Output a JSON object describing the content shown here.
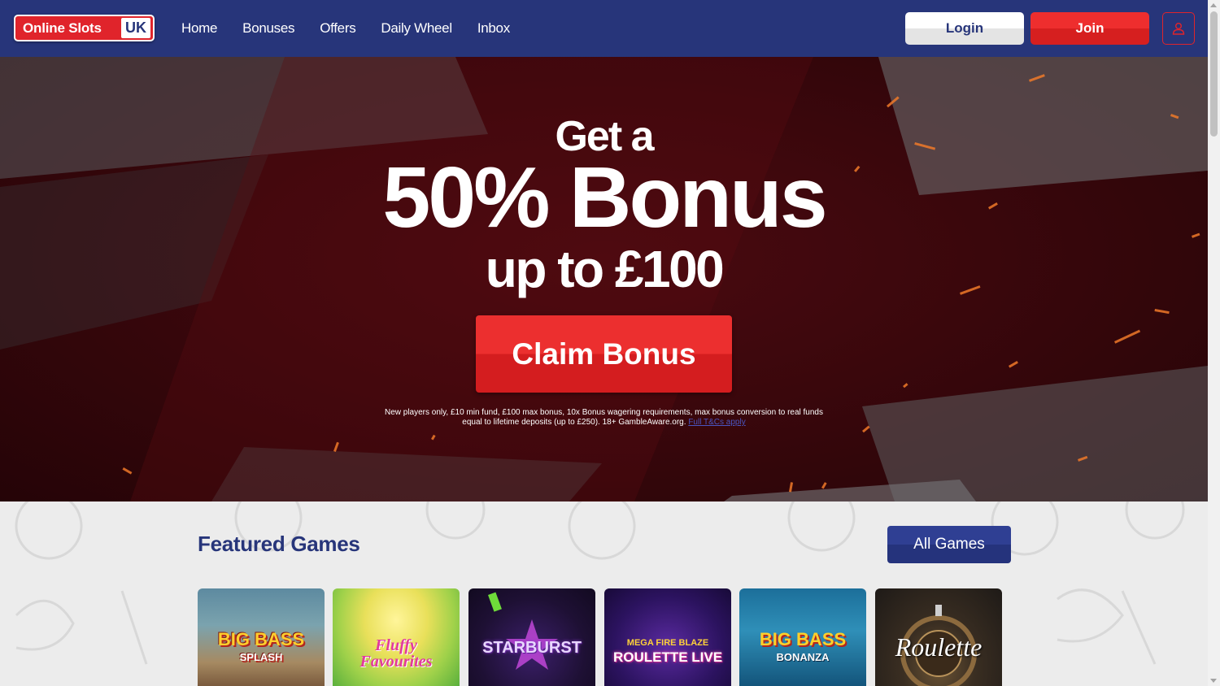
{
  "header": {
    "logo_main": "Online Slots",
    "logo_uk": "UK",
    "nav": [
      "Home",
      "Bonuses",
      "Offers",
      "Daily Wheel",
      "Inbox"
    ],
    "login_label": "Login",
    "join_label": "Join",
    "account_icon": "user-icon"
  },
  "hero": {
    "pre": "Get a",
    "main": "50% Bonus",
    "sub": "up to £100",
    "cta_label": "Claim Bonus",
    "terms_line1": "New players only, £10 min fund, £100 max bonus, 10x Bonus wagering requirements, max bonus conversion to real funds",
    "terms_line2": "equal to lifetime deposits (up to £250). 18+ GambleAware.org.",
    "terms_link": "Full T&Cs apply"
  },
  "featured": {
    "title": "Featured Games",
    "all_games_label": "All Games",
    "games": [
      {
        "name": "Big Bass Splash",
        "line1": "BIG BASS",
        "line2": "SPLASH"
      },
      {
        "name": "Fluffy Favourites",
        "line1": "Fluffy",
        "line2": "Favourites"
      },
      {
        "name": "Starburst",
        "line1": "STARBURST",
        "line2": ""
      },
      {
        "name": "Mega Fire Blaze Roulette Live",
        "line1": "MEGA FIRE BLAZE",
        "line2": "ROULETTE LIVE"
      },
      {
        "name": "Big Bass Bonanza",
        "line1": "BIG BASS",
        "line2": "BONANZA"
      },
      {
        "name": "Roulette",
        "line1": "Roulette",
        "line2": ""
      }
    ]
  },
  "colors": {
    "navy": "#27357a",
    "red": "#e0242b",
    "light_bg": "#ececec"
  }
}
